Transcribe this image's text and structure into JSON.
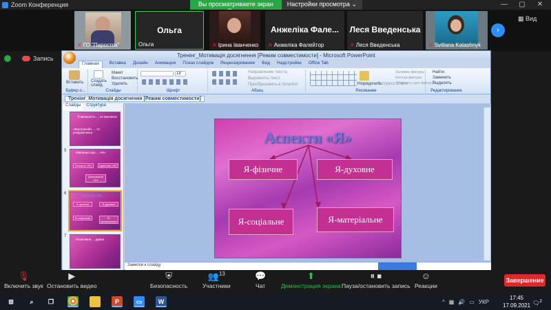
{
  "zoom": {
    "title": "Zoom Конференция",
    "share_banner": "Вы просматриваете экран Ольга",
    "view_settings": "Настройки просмотра",
    "view_label": "Вид",
    "recording": "Запись"
  },
  "participants": [
    {
      "name": "ГО \"Паросток\"",
      "display": ""
    },
    {
      "name": "Ольга",
      "display": "Ольга"
    },
    {
      "name": "Ірина Іванченко",
      "display": ""
    },
    {
      "name": "Анжеліка Фалейтор",
      "display": "Анжеліка Фале..."
    },
    {
      "name": "Леся Введенська",
      "display": "Леся Введенська"
    },
    {
      "name": "Svitlana Kalashnyk",
      "display": ""
    }
  ],
  "powerpoint": {
    "window_title": "Тренінг_Мотивація досягнення [Режим совместимости] - Microsoft PowerPoint",
    "tabs": [
      "Главная",
      "Вставка",
      "Дизайн",
      "Анимация",
      "Показ слайдов",
      "Рецензирование",
      "Вид",
      "Надстройки",
      "Office Tab"
    ],
    "ribbon": {
      "paste": "Вставить",
      "create_slide": "Создать слайд",
      "layout": "Макет",
      "restore": "Восстановить",
      "delete": "Удалить",
      "arrange": "Упорядочить",
      "quick_styles": "Экспресс-стили",
      "find": "Найти",
      "replace": "Заменить",
      "select": "Выделить",
      "text_direction": "Направление текста",
      "align_text": "Выровнять текст",
      "smartart": "Преобразовать в SmartArt",
      "shape_fill": "Заливка фигуры",
      "shape_outline": "Контур фигуры",
      "shape_effects": "Эффекты для фигур",
      "font_size": "18",
      "groups": [
        "Буфер о...",
        "Слайды",
        "Шрифт",
        "Абзац",
        "Рисование",
        "Редактирование"
      ]
    },
    "doc_tab": "Тренінг_Мотивація досягнення [Режим совместимости]",
    "panel_tabs": [
      "Слайды",
      "Структура"
    ],
    "notes": "Заметки к слайду",
    "slide": {
      "title": "Аспекти «Я»",
      "boxes": [
        "Я-фізичне",
        "Я-духовне",
        "Я-соціальне",
        "Я-матеріальне"
      ]
    },
    "thumbs": [
      {
        "n": "",
        "t1": "Ⓟовнішність ... не визначає",
        "t2": "«Внутрішній» ... ти усвідомлюєш"
      },
      {
        "n": "5",
        "t1": "Уявлення про ... «Я»",
        "t2": "Реальне «Я»",
        "t3": "Ідеальне «Я»",
        "t4": "Дзеркальне «Я»"
      },
      {
        "n": "6",
        "t1": "Аспекти «Я»",
        "t2": "Я-фізичне",
        "t3": "Я-духовне",
        "t4": "Я-соціальне",
        "t5": "Я-матеріальне"
      },
      {
        "n": "7",
        "t1": "Позитивна ... думка",
        "t2": ""
      }
    ]
  },
  "toolbar": {
    "mute": "Включить звук",
    "video": "Остановить видео",
    "security": "Безопасность",
    "participants": "Участники",
    "participants_count": "13",
    "chat": "Чат",
    "share": "Демонстрация экрана",
    "record": "Пауза/остановить запись",
    "reactions": "Реакции",
    "end": "Завершение"
  },
  "taskbar": {
    "lang": "УКР",
    "time": "17:45",
    "date": "17.09.2021",
    "notifications": "2"
  }
}
